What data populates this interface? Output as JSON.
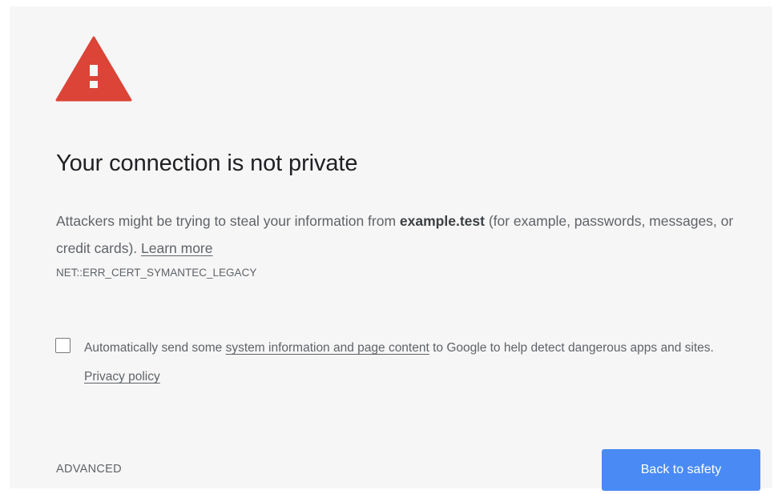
{
  "title": "Your connection is not private",
  "description": {
    "prefix": "Attackers might be trying to steal your information from ",
    "site": "example.test",
    "suffix": " (for example, passwords, messages, or credit cards). ",
    "learn_more": "Learn more"
  },
  "error_code": "NET::ERR_CERT_SYMANTEC_LEGACY",
  "optin": {
    "checked": false,
    "prefix": "Automatically send some ",
    "link_text": "system information and page content",
    "middle": " to Google to help detect dangerous apps and sites. ",
    "privacy_link": "Privacy policy"
  },
  "actions": {
    "advanced_label": "ADVANCED",
    "back_label": "Back to safety"
  },
  "colors": {
    "warning_red": "#db4437",
    "primary_blue": "#4a8af4",
    "background": "#f6f6f6"
  },
  "icons": {
    "warning": "warning-triangle-icon"
  }
}
